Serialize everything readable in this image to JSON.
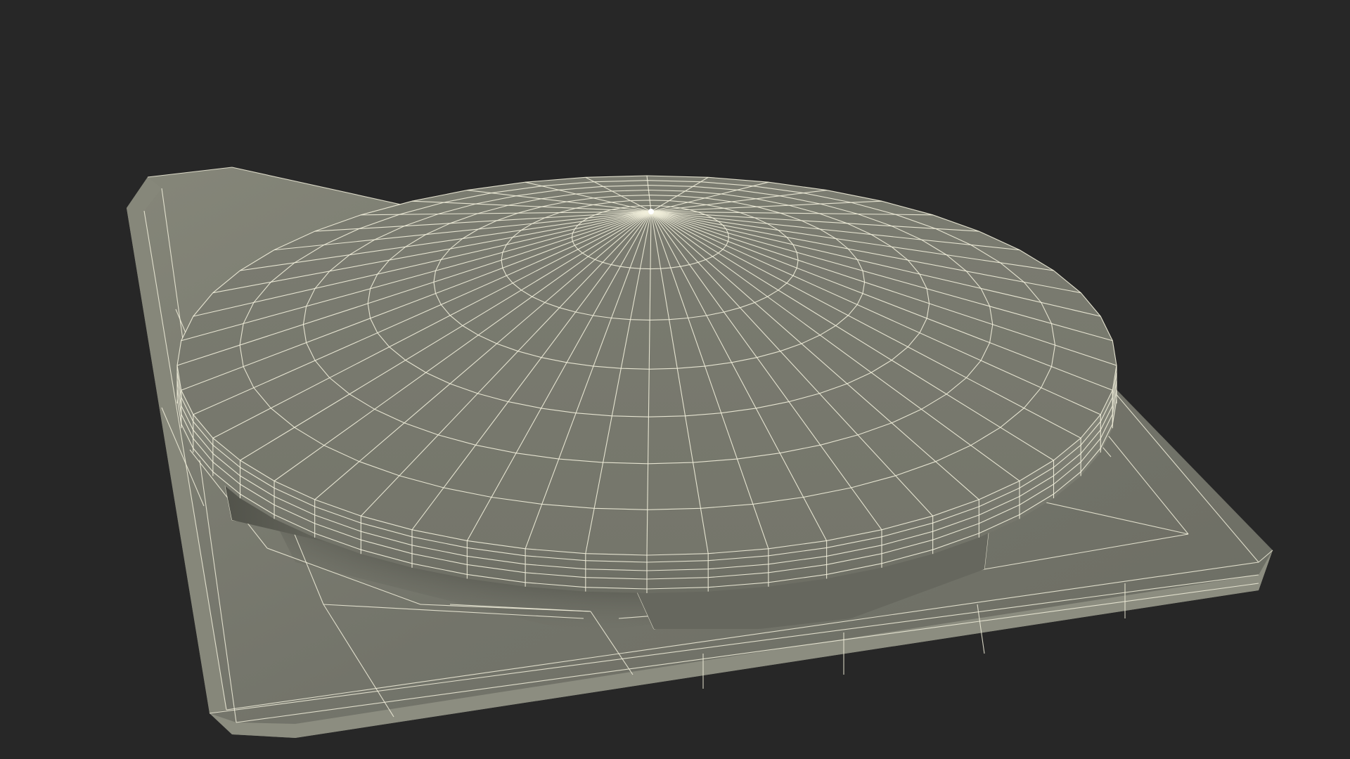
{
  "scene": {
    "background_color": "#272727",
    "model": {
      "description_icon": "round-vent-cap-wireframe",
      "shade_light": "#7d7e73",
      "shade_mid": "#6a6b61",
      "shade_dark": "#3b3c36",
      "wire_color": "#f2f0dc",
      "disc_radial_segments": 48,
      "disc_rings": 7
    }
  }
}
